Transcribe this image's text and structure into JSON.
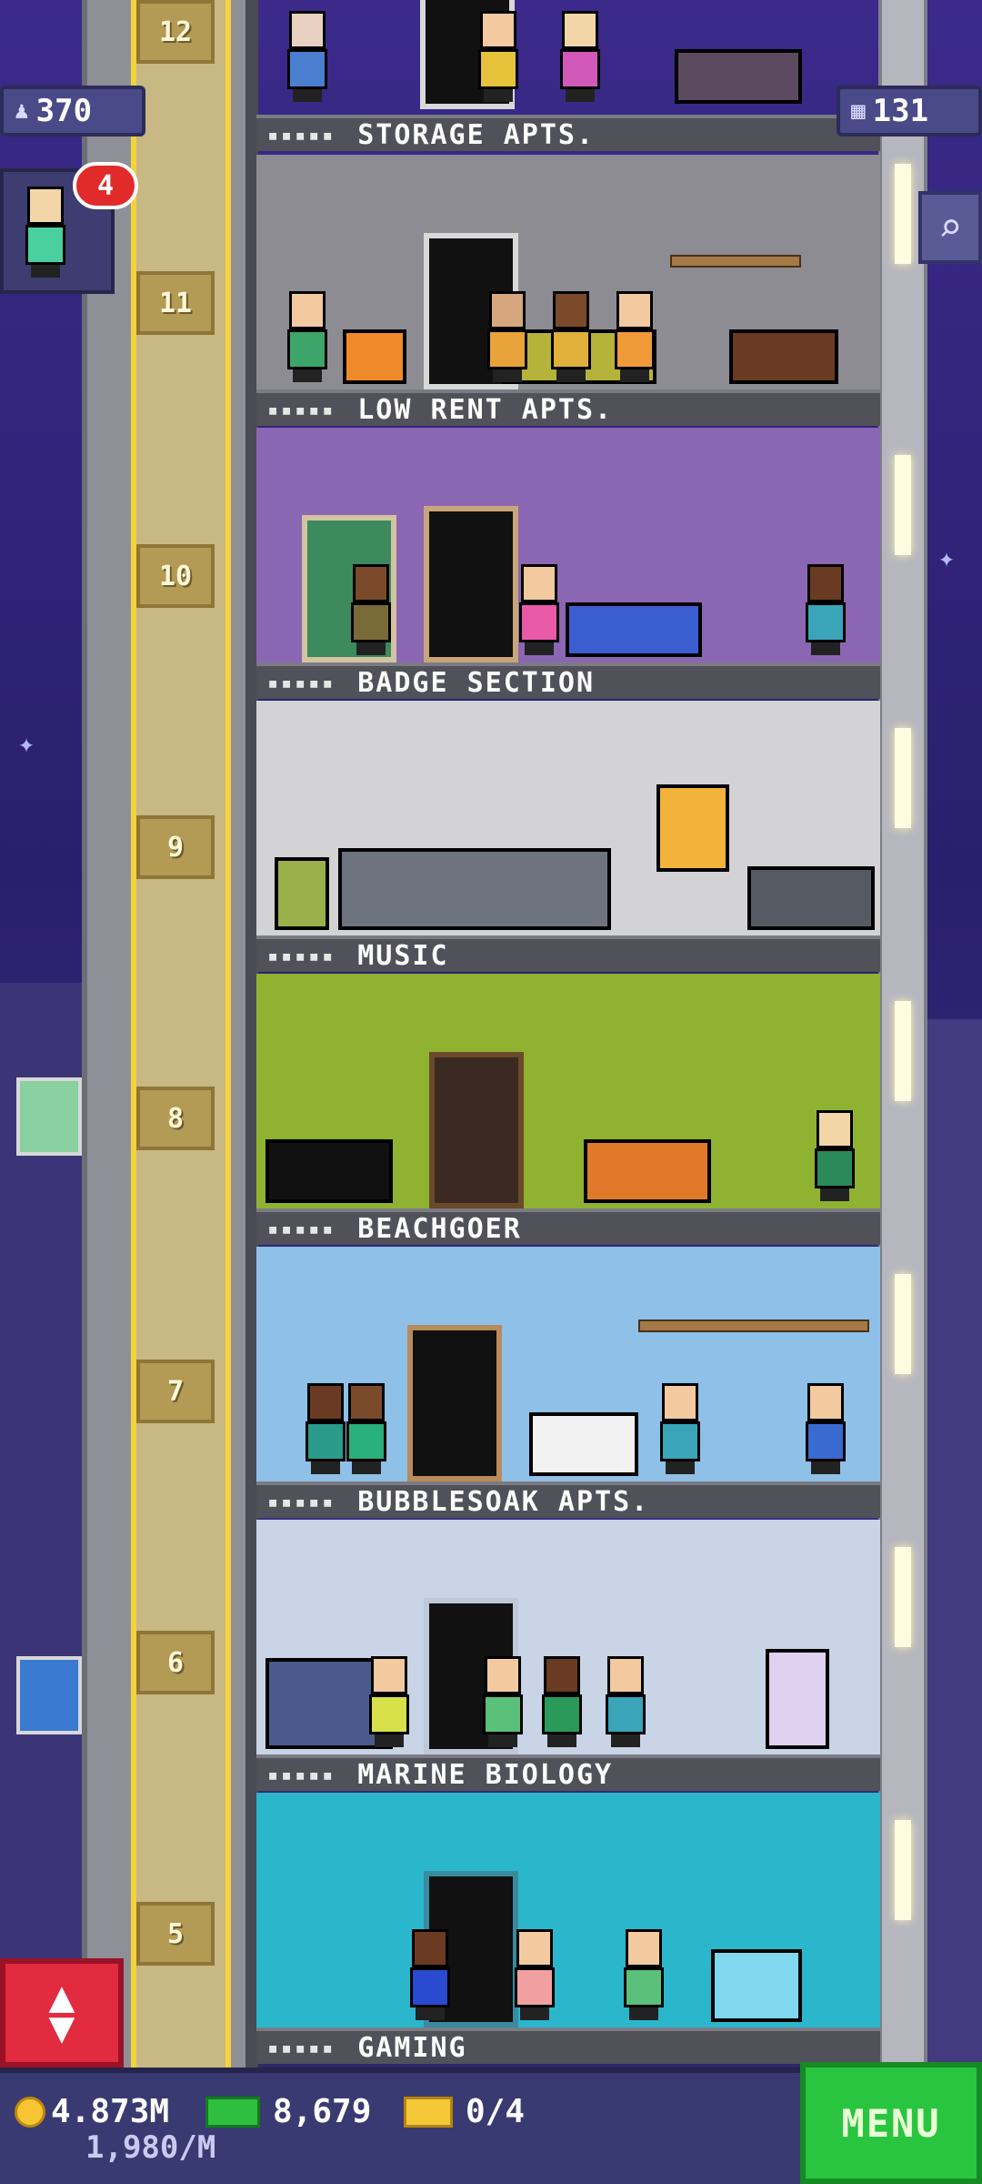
{
  "hud": {
    "population": "370",
    "population_icon": "person-icon",
    "floors": "131",
    "floors_icon": "building-icon",
    "visitor_badge": "4"
  },
  "floors": [
    {
      "number": "12",
      "name": "STORAGE APTS.",
      "rating": "▪▪▪▪▪",
      "wall": "#a59f98",
      "floor": "#6b4a35"
    },
    {
      "number": "11",
      "name": "LOW RENT APTS.",
      "rating": "▪▪▪▪▪",
      "wall": "#8e8c93",
      "floor": "#6a3f28"
    },
    {
      "number": "10",
      "name": "BADGE SECTION",
      "rating": "▪▪▪▪▪",
      "wall": "#8b66b2",
      "floor": "#3a6b45"
    },
    {
      "number": "9",
      "name": "MUSIC",
      "rating": "▪▪▪▪▪",
      "wall": "#d3d3d6",
      "floor": "#7a7a80"
    },
    {
      "number": "8",
      "name": "BEACHGOER",
      "rating": "▪▪▪▪▪",
      "wall": "#8fb330",
      "floor": "#35a83a"
    },
    {
      "number": "7",
      "name": "BUBBLESOAK APTS.",
      "rating": "▪▪▪▪▪",
      "wall": "#8fc0e8",
      "floor": "#c8a77d"
    },
    {
      "number": "6",
      "name": "MARINE BIOLOGY",
      "rating": "▪▪▪▪▪",
      "wall": "#c9d4e6",
      "floor": "#7a7f8a"
    },
    {
      "number": "5",
      "name": "GAMING",
      "rating": "▪▪▪▪▪",
      "wall": "#2ab7cc",
      "floor": "#5a6d78"
    }
  ],
  "bottom": {
    "coins": "4.873M",
    "bux": "8,679",
    "tickets": "0/4",
    "coin_rate": "1,980/M",
    "menu_label": "MENU"
  },
  "icons": {
    "elevator": "▲\n▼",
    "search": "⌕"
  }
}
